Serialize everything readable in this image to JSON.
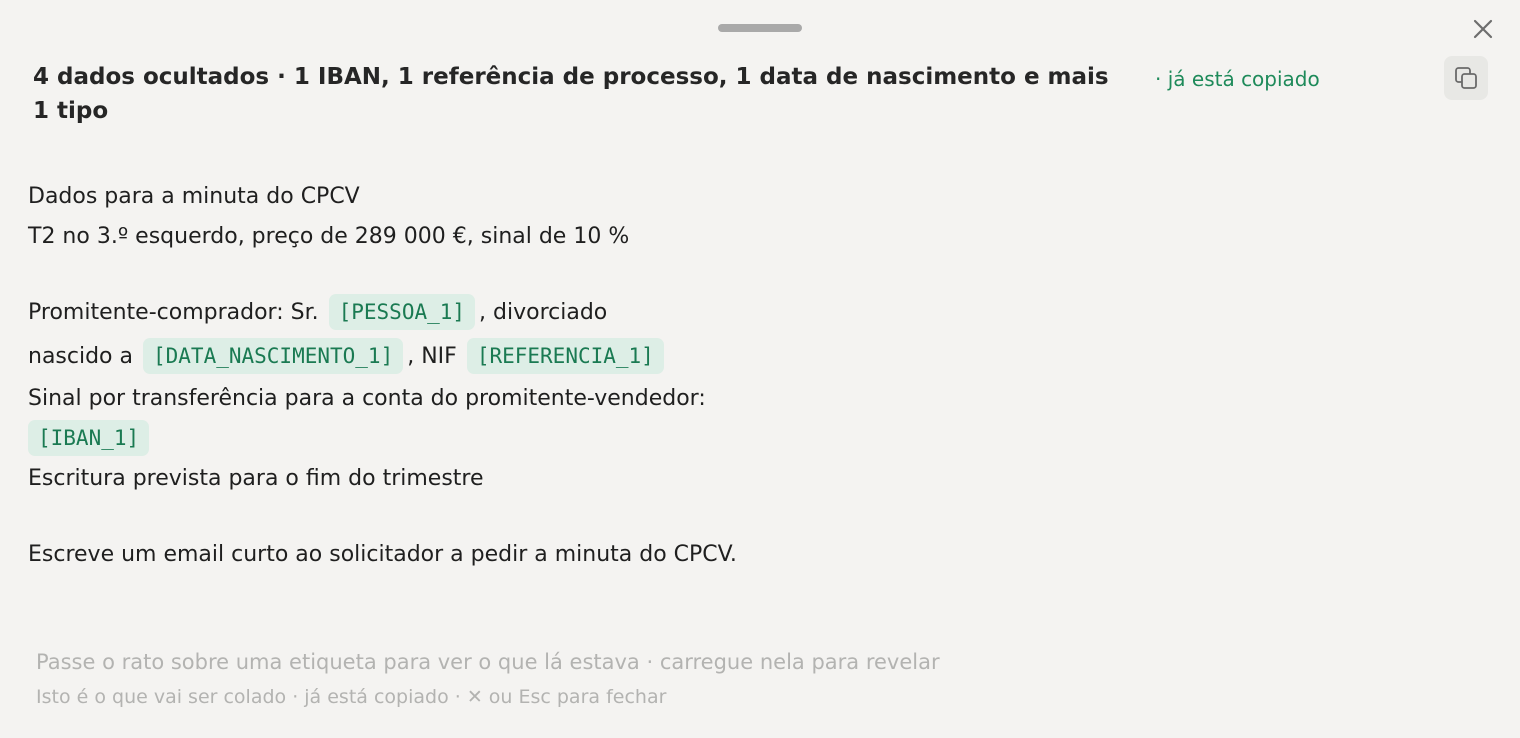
{
  "colors": {
    "background": "#f4f3f1",
    "accent_green": "#1e8a5a",
    "tag_background": "#ddeee6",
    "hint_gray": "#b3b3b1"
  },
  "icons": {
    "close": "close-icon",
    "copy": "copy-icon",
    "handle": "drag-handle"
  },
  "header": {
    "summary_line1": "4 dados ocultados · 1 IBAN, 1 referência de processo, 1 data de nascimento e mais",
    "summary_line2": "1 tipo",
    "copied_status": "· já está copiado"
  },
  "content": {
    "title": "Dados para a minuta do CPCV",
    "details": "T2 no 3.º esquerdo, preço de 289 000 €, sinal de 10 %",
    "buyer_prefix": "Promitente-comprador: Sr.",
    "buyer_tag": "[PESSOA_1]",
    "buyer_suffix": ", divorciado",
    "birth_prefix": "nascido a",
    "birth_tag": "[DATA_NASCIMENTO_1]",
    "nif_label": ", NIF",
    "nif_tag": "[REFERENCIA_1]",
    "transfer_text": "Sinal por transferência para a conta do promitente-vendedor:",
    "iban_tag": "[IBAN_1]",
    "deed_text": "Escritura prevista para o fim do trimestre",
    "instruction": "Escreve um email curto ao solicitador a pedir a minuta do CPCV."
  },
  "footer": {
    "hint_primary": "Passe o rato sobre uma etiqueta para ver o que lá estava · carregue nela para revelar",
    "hint_secondary": "Isto é o que vai ser colado · já está copiado · ✕ ou Esc para fechar"
  }
}
